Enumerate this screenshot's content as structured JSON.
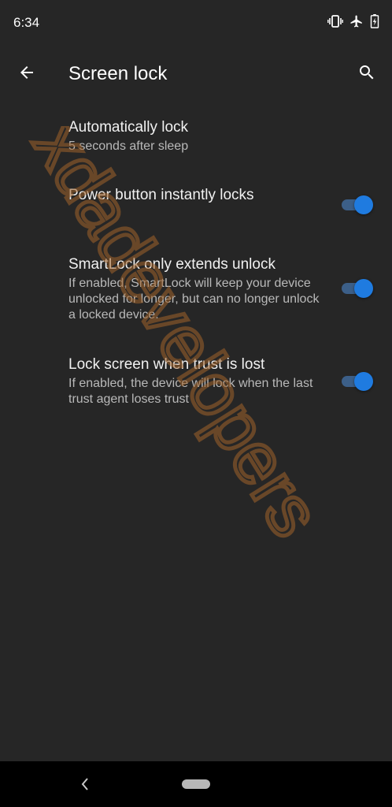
{
  "status_bar": {
    "time": "6:34",
    "icons": [
      "vibrate-icon",
      "airplane-mode-icon",
      "battery-charging-icon"
    ]
  },
  "app_bar": {
    "title": "Screen lock",
    "back_icon": "arrow-back-icon",
    "search_icon": "search-icon"
  },
  "preferences": [
    {
      "title": "Automatically lock",
      "summary": "5 seconds after sleep"
    },
    {
      "title": "Power button instantly locks",
      "summary": "",
      "switch_on": true
    },
    {
      "title": "SmartLock only extends unlock",
      "summary": "If enabled, SmartLock will keep your device unlocked for longer, but can no longer unlock a locked device.",
      "switch_on": true
    },
    {
      "title": "Lock screen when trust is lost",
      "summary": "If enabled, the device will lock when the last trust agent loses trust",
      "switch_on": true
    }
  ],
  "colors": {
    "background": "#262626",
    "accent": "#1f7be0",
    "switch_track": "#3c5f88",
    "watermark": "#a0622a"
  },
  "watermark_text": "xdadevelopers",
  "nav_bar": {
    "back_icon": "nav-back-icon",
    "home_icon": "nav-home-pill"
  }
}
